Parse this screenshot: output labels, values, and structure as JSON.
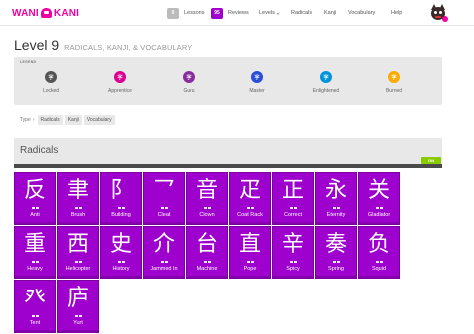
{
  "nav": {
    "logo_left": "WANI",
    "logo_right": "KANI",
    "lessons_count": "0",
    "lessons_label": "Lessons",
    "reviews_count": "95",
    "reviews_label": "Reviews",
    "levels_label": "Levels",
    "radicals_label": "Radicals",
    "kanji_label": "Kanji",
    "vocabulary_label": "Vocabulary",
    "help_label": "Help"
  },
  "header": {
    "level": "Level 9",
    "subtitle": "RADICALS, KANJI, & VOCABULARY"
  },
  "legend": {
    "title": "LEGEND",
    "items": [
      {
        "label": "Locked",
        "color": "#555555",
        "glyph": "字"
      },
      {
        "label": "Apprentice",
        "color": "#dd0093",
        "glyph": "字"
      },
      {
        "label": "Guru",
        "color": "#882d9e",
        "glyph": "字"
      },
      {
        "label": "Master",
        "color": "#294ddb",
        "glyph": "字"
      },
      {
        "label": "Enlightened",
        "color": "#0093dd",
        "glyph": "字"
      },
      {
        "label": "Burned",
        "color": "#faac05",
        "glyph": "字"
      }
    ]
  },
  "filters": {
    "type_label": "Type",
    "options": [
      "Radicals",
      "Kanji",
      "Vocabulary"
    ]
  },
  "section": {
    "title": "Radicals",
    "toggle_label": "ON"
  },
  "colors": {
    "radical": "#9e00ce",
    "brand": "#f100a1"
  },
  "radicals": [
    {
      "glyph": "反",
      "name": "Anti"
    },
    {
      "glyph": "聿",
      "name": "Brush"
    },
    {
      "glyph": "阝",
      "name": "Building"
    },
    {
      "glyph": "乛",
      "name": "Cleat"
    },
    {
      "glyph": "音",
      "name": "Clown"
    },
    {
      "glyph": "疋",
      "name": "Coat Rack"
    },
    {
      "glyph": "正",
      "name": "Correct"
    },
    {
      "glyph": "永",
      "name": "Eternity"
    },
    {
      "glyph": "关",
      "name": "Gladiator"
    },
    {
      "glyph": "重",
      "name": "Heavy"
    },
    {
      "glyph": "西",
      "name": "Helicopter"
    },
    {
      "glyph": "史",
      "name": "History"
    },
    {
      "glyph": "介",
      "name": "Jammed In"
    },
    {
      "glyph": "台",
      "name": "Machine"
    },
    {
      "glyph": "直",
      "name": "Pope"
    },
    {
      "glyph": "辛",
      "name": "Spicy"
    },
    {
      "glyph": "奏",
      "name": "Spring"
    },
    {
      "glyph": "负",
      "name": "Squid"
    },
    {
      "glyph": "癶",
      "name": "Tent"
    },
    {
      "glyph": "庐",
      "name": "Yurt"
    }
  ]
}
